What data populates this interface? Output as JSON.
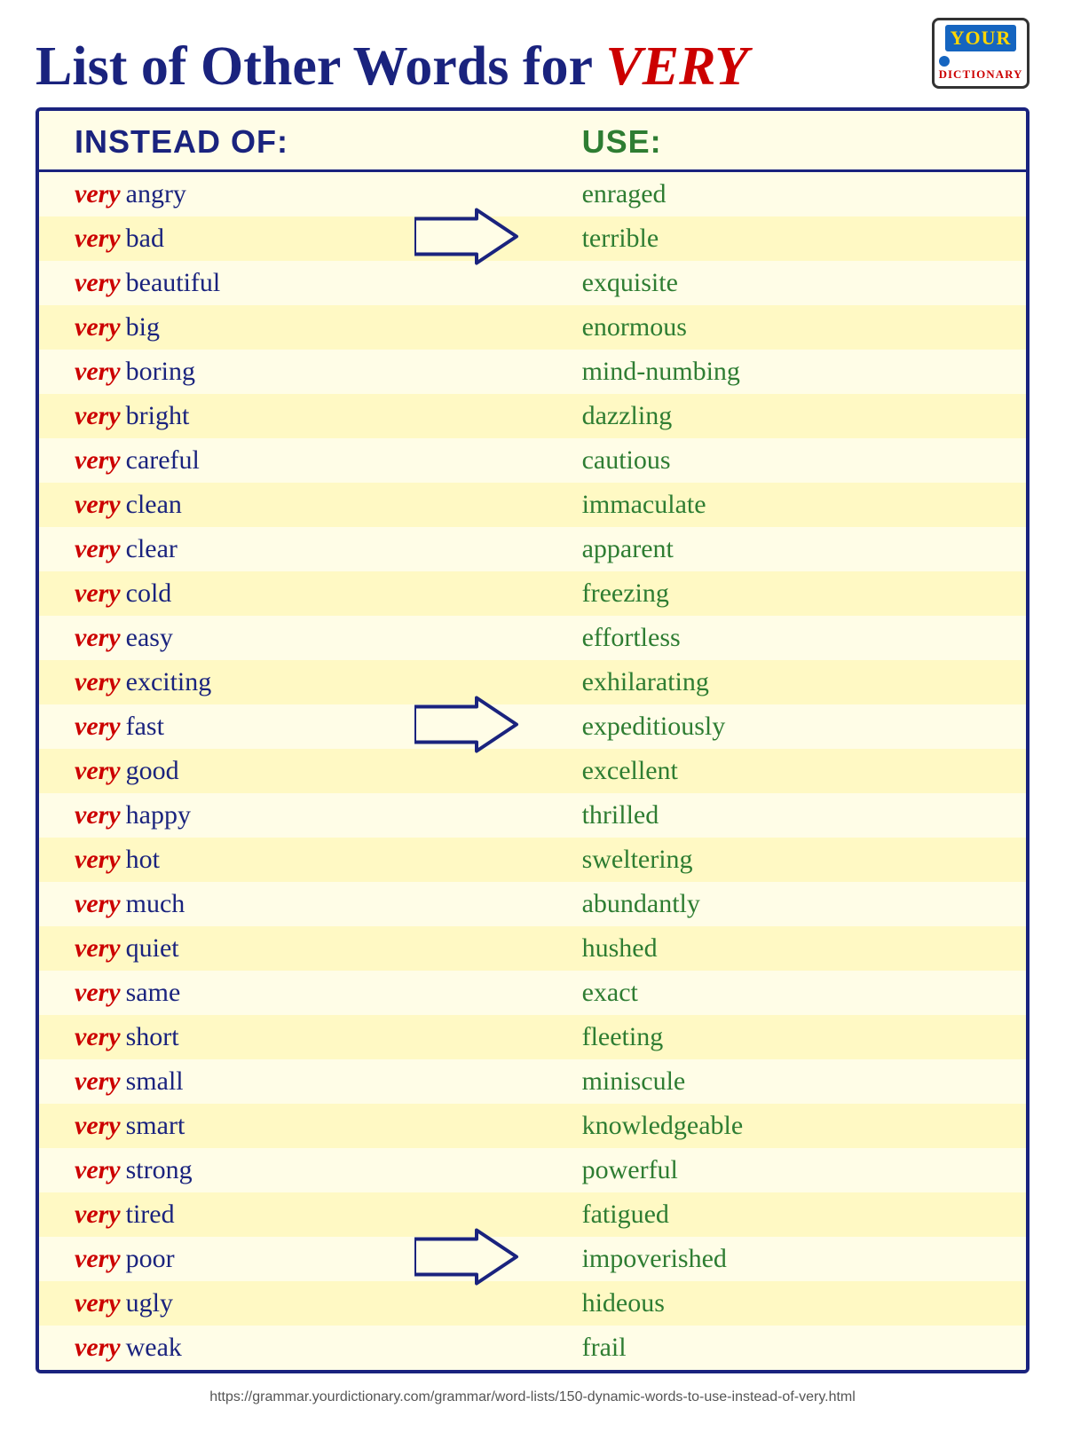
{
  "title": {
    "prefix": "List of Other Words for ",
    "highlight": "VERY"
  },
  "header_col1": "INSTEAD OF:",
  "header_col2": "USE:",
  "footer_url": "https://grammar.yourdictionary.com/grammar/word-lists/150-dynamic-words-to-use-instead-of-very.html",
  "logo": {
    "your": "YOUR",
    "dictionary": "DICTIONARY"
  },
  "rows": [
    {
      "very": "very",
      "adj": "angry",
      "use": "enraged",
      "arrow": false
    },
    {
      "very": "very",
      "adj": "bad",
      "use": "terrible",
      "arrow": true
    },
    {
      "very": "very",
      "adj": "beautiful",
      "use": "exquisite",
      "arrow": false
    },
    {
      "very": "very",
      "adj": "big",
      "use": "enormous",
      "arrow": false
    },
    {
      "very": "very",
      "adj": "boring",
      "use": "mind-numbing",
      "arrow": false
    },
    {
      "very": "very",
      "adj": "bright",
      "use": "dazzling",
      "arrow": false
    },
    {
      "very": "very",
      "adj": "careful",
      "use": "cautious",
      "arrow": false
    },
    {
      "very": "very",
      "adj": "clean",
      "use": "immaculate",
      "arrow": false
    },
    {
      "very": "very",
      "adj": "clear",
      "use": "apparent",
      "arrow": false
    },
    {
      "very": "very",
      "adj": "cold",
      "use": "freezing",
      "arrow": false
    },
    {
      "very": "very",
      "adj": "easy",
      "use": "effortless",
      "arrow": false
    },
    {
      "very": "very",
      "adj": "exciting",
      "use": "exhilarating",
      "arrow": false
    },
    {
      "very": "very",
      "adj": "fast",
      "use": "expeditiously",
      "arrow": true
    },
    {
      "very": "very",
      "adj": "good",
      "use": "excellent",
      "arrow": false
    },
    {
      "very": "very",
      "adj": "happy",
      "use": "thrilled",
      "arrow": false
    },
    {
      "very": "very",
      "adj": "hot",
      "use": "sweltering",
      "arrow": false
    },
    {
      "very": "very",
      "adj": "much",
      "use": "abundantly",
      "arrow": false
    },
    {
      "very": "very",
      "adj": "quiet",
      "use": "hushed",
      "arrow": false
    },
    {
      "very": "very",
      "adj": "same",
      "use": "exact",
      "arrow": false
    },
    {
      "very": "very",
      "adj": "short",
      "use": "fleeting",
      "arrow": false
    },
    {
      "very": "very",
      "adj": "small",
      "use": "miniscule",
      "arrow": false
    },
    {
      "very": "very",
      "adj": "smart",
      "use": "knowledgeable",
      "arrow": false
    },
    {
      "very": "very",
      "adj": "strong",
      "use": "powerful",
      "arrow": false
    },
    {
      "very": "very",
      "adj": "tired",
      "use": "fatigued",
      "arrow": false
    },
    {
      "very": "very",
      "adj": "poor",
      "use": "impoverished",
      "arrow": true
    },
    {
      "very": "very",
      "adj": "ugly",
      "use": "hideous",
      "arrow": false
    },
    {
      "very": "very",
      "adj": "weak",
      "use": "frail",
      "arrow": false
    }
  ]
}
